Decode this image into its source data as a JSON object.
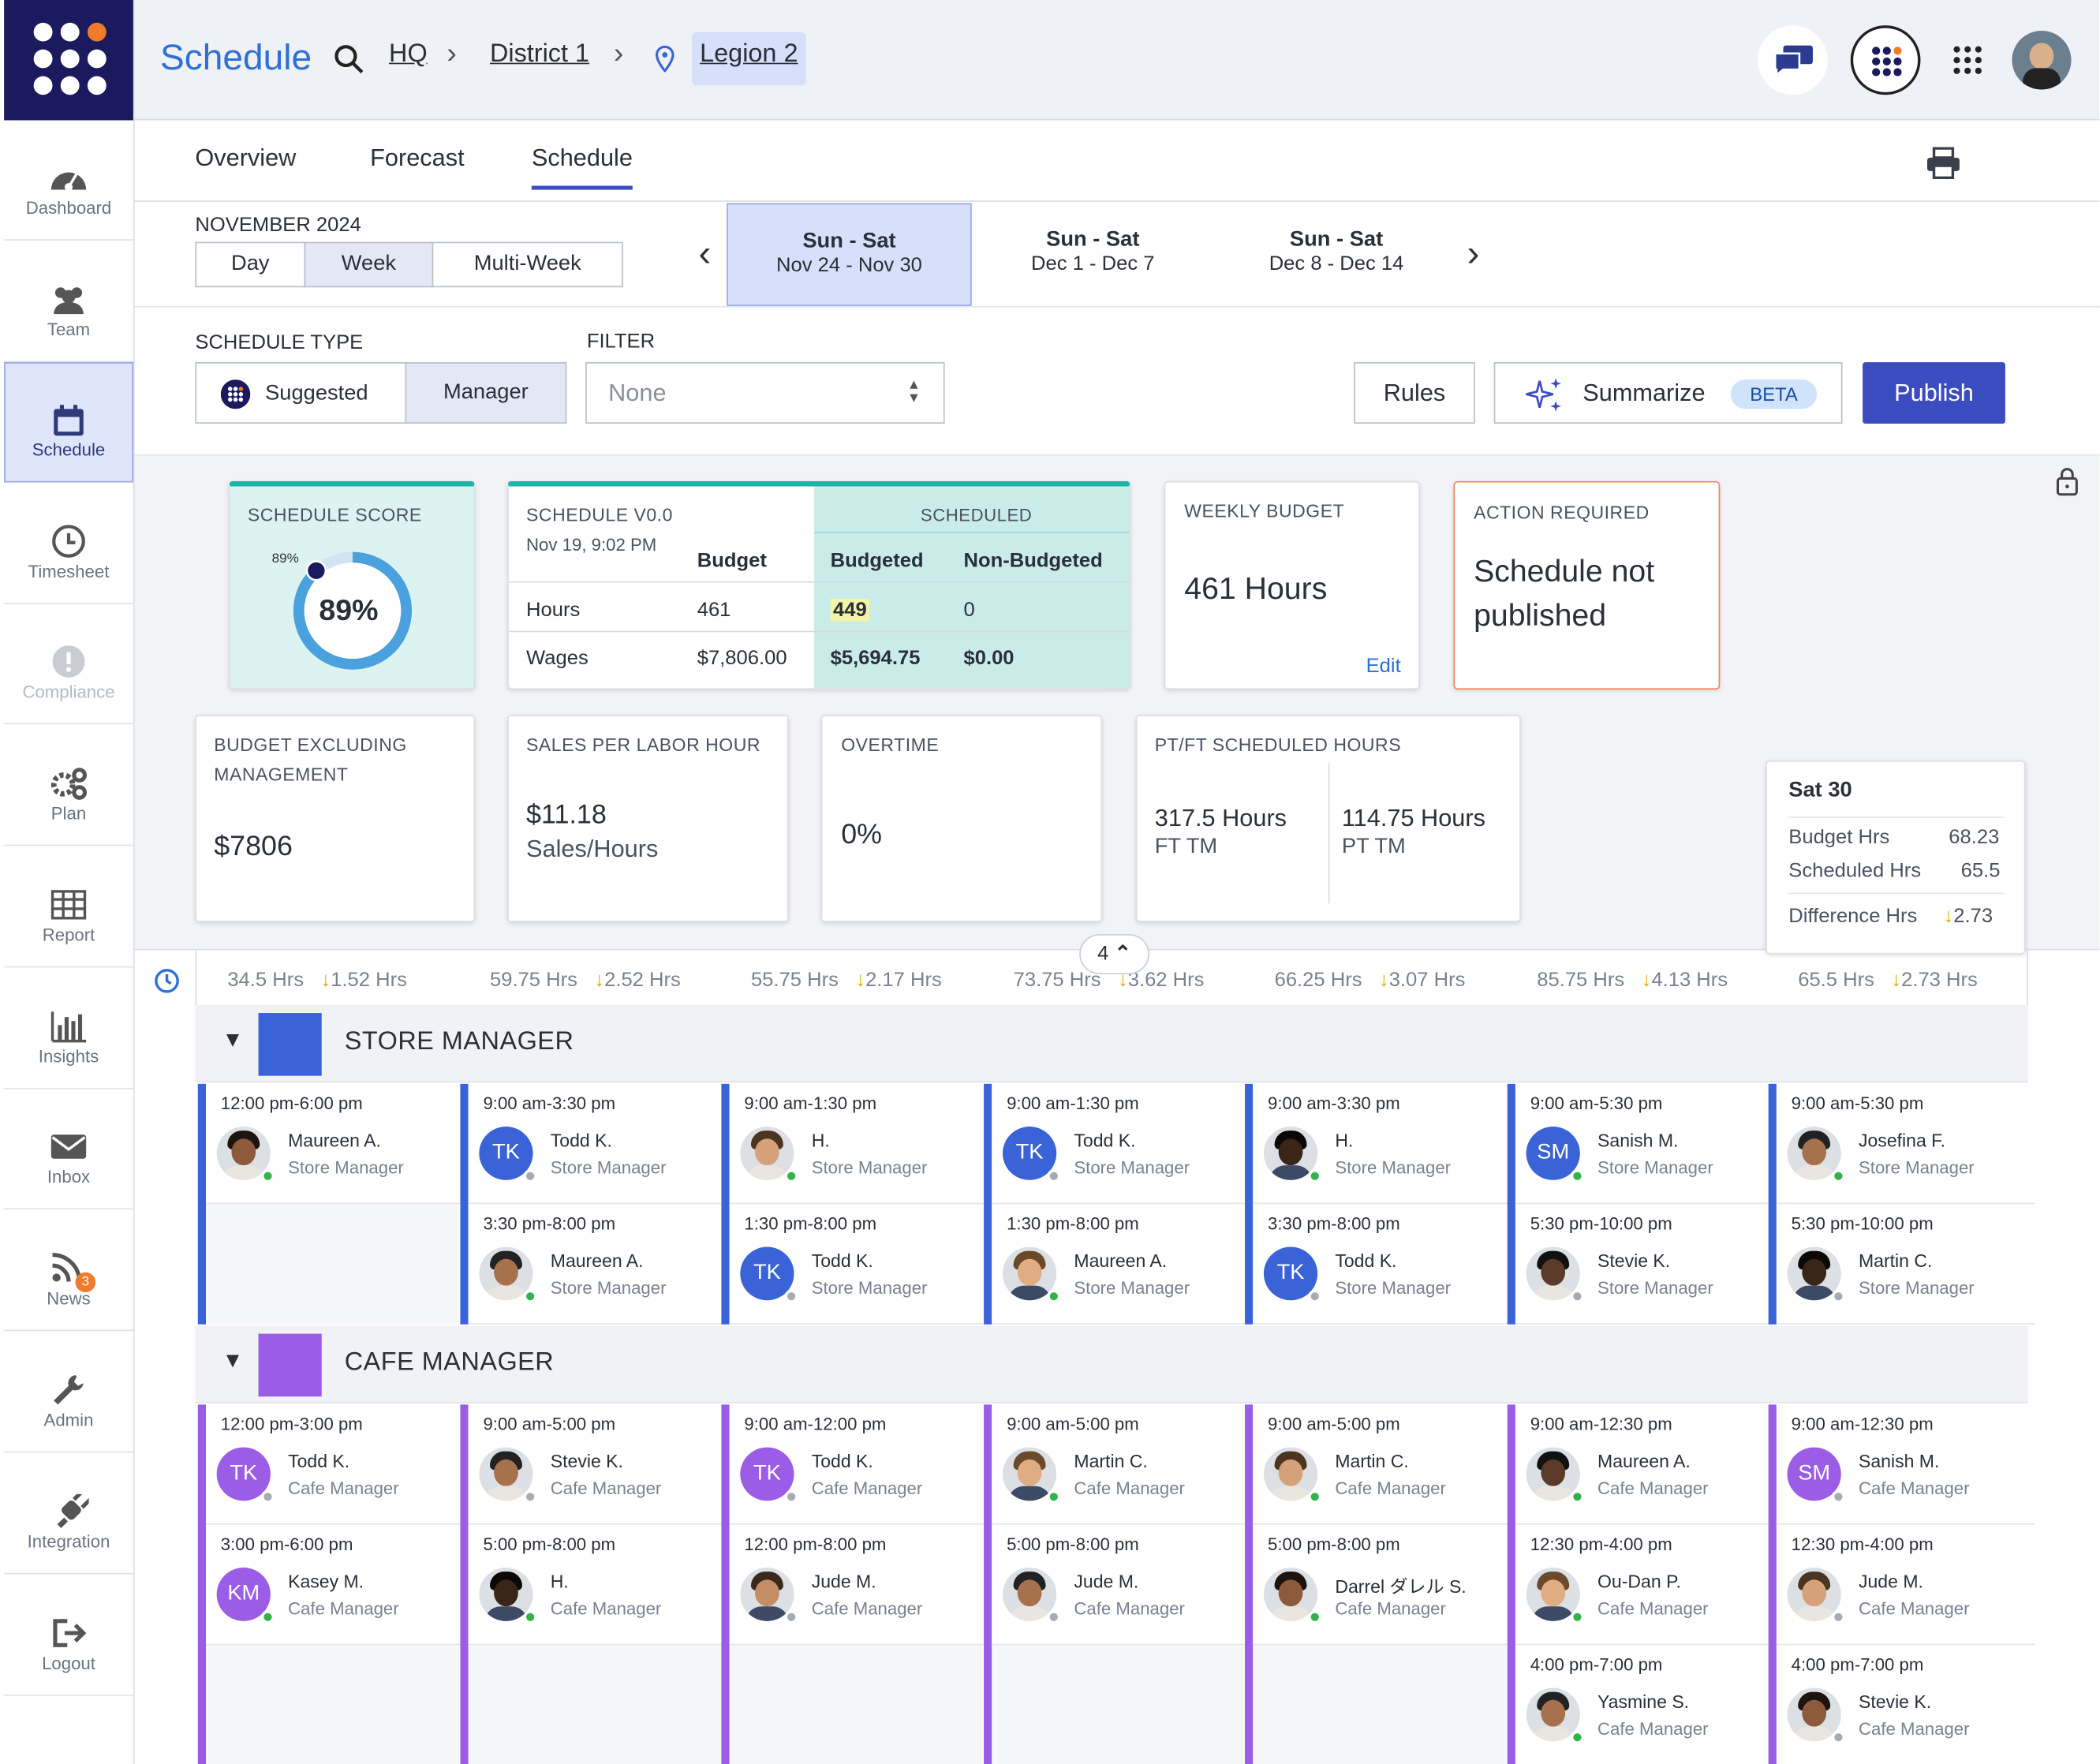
{
  "app": {
    "title": "Schedule"
  },
  "breadcrumb": [
    "HQ",
    "District 1",
    "Legion 2"
  ],
  "sidebar": [
    {
      "label": "Dashboard",
      "icon": "dashboard-icon"
    },
    {
      "label": "Team",
      "icon": "team-icon"
    },
    {
      "label": "Schedule",
      "icon": "calendar-icon",
      "active": true
    },
    {
      "label": "Timesheet",
      "icon": "clock-icon"
    },
    {
      "label": "Compliance",
      "icon": "alert-icon"
    },
    {
      "label": "Plan",
      "icon": "gears-icon"
    },
    {
      "label": "Report",
      "icon": "table-icon"
    },
    {
      "label": "Insights",
      "icon": "bar-chart-icon"
    },
    {
      "label": "Inbox",
      "icon": "mail-icon"
    },
    {
      "label": "News",
      "icon": "rss-icon",
      "badge": "3"
    },
    {
      "label": "Admin",
      "icon": "wrench-icon"
    },
    {
      "label": "Integration",
      "icon": "plug-icon"
    },
    {
      "label": "Logout",
      "icon": "logout-icon"
    }
  ],
  "tabs": [
    "Overview",
    "Forecast",
    "Schedule"
  ],
  "month": "NOVEMBER 2024",
  "view_modes": [
    "Day",
    "Week",
    "Multi-Week"
  ],
  "weeks": [
    {
      "days": "Sun - Sat",
      "range": "Nov 24 - Nov 30"
    },
    {
      "days": "Sun - Sat",
      "range": "Dec 1 - Dec 7"
    },
    {
      "days": "Sun - Sat",
      "range": "Dec 8 - Dec 14"
    }
  ],
  "schedule_type": {
    "label": "SCHEDULE TYPE",
    "options": [
      "Suggested",
      "Manager"
    ]
  },
  "filter": {
    "label": "FILTER",
    "value": "None"
  },
  "buttons": {
    "rules": "Rules",
    "summarize": "Summarize",
    "beta": "BETA",
    "publish": "Publish"
  },
  "score": {
    "title": "SCHEDULE SCORE",
    "value": "89%",
    "marker": "89%",
    "fraction": 0.89
  },
  "version": {
    "title": "SCHEDULE V0.0",
    "date": "Nov 19, 9:02 PM",
    "scheduled_label": "SCHEDULED",
    "headers": [
      "Budget",
      "Budgeted",
      "Non-Budgeted"
    ],
    "rows": [
      {
        "label": "Hours",
        "budget": "461",
        "budgeted": "449",
        "non": "0"
      },
      {
        "label": "Wages",
        "budget": "$7,806.00",
        "budgeted": "$5,694.75",
        "non": "$0.00"
      }
    ]
  },
  "weekly_budget": {
    "title": "WEEKLY BUDGET",
    "value": "461 Hours",
    "edit": "Edit"
  },
  "action": {
    "title": "ACTION REQUIRED",
    "line1": "Schedule not",
    "line2": "published"
  },
  "budget_ex": {
    "title1": "BUDGET EXCLUDING",
    "title2": "MANAGEMENT",
    "value": "$7806"
  },
  "splh": {
    "title": "SALES PER LABOR HOUR",
    "value": "$11.18",
    "unit": "Sales/Hours"
  },
  "overtime": {
    "title": "OVERTIME",
    "value": "0%"
  },
  "ptft": {
    "title": "PT/FT SCHEDULED HOURS",
    "ft_value": "317.5 Hours",
    "ft_label": "FT TM",
    "pt_value": "114.75 Hours",
    "pt_label": "PT TM"
  },
  "tooltip": {
    "title": "Sat 30",
    "rows": [
      {
        "k": "Budget Hrs",
        "v": "68.23"
      },
      {
        "k": "Scheduled Hrs",
        "v": "65.5"
      }
    ],
    "diff_k": "Difference Hrs",
    "diff_v": "2.73"
  },
  "collapse_count": "4",
  "day_hours": [
    {
      "hrs": "34.5 Hrs",
      "diff": "1.52 Hrs"
    },
    {
      "hrs": "59.75 Hrs",
      "diff": "2.52 Hrs"
    },
    {
      "hrs": "55.75 Hrs",
      "diff": "2.17 Hrs"
    },
    {
      "hrs": "73.75 Hrs",
      "diff": "3.62 Hrs"
    },
    {
      "hrs": "66.25 Hrs",
      "diff": "3.07 Hrs"
    },
    {
      "hrs": "85.75 Hrs",
      "diff": "4.13 Hrs"
    },
    {
      "hrs": "65.5 Hrs",
      "diff": "2.73 Hrs"
    }
  ],
  "groups": [
    {
      "title": "STORE MANAGER",
      "color": "#3a63d8",
      "days": [
        [
          {
            "time": "12:00 pm-6:00 pm",
            "name": "Maureen A.",
            "role": "Store Manager",
            "avatar": "photo",
            "online": true
          }
        ],
        [
          {
            "time": "9:00 am-3:30 pm",
            "name": "Todd K.",
            "role": "Store Manager",
            "initials": "TK",
            "avatar": "#3a63d8"
          },
          {
            "time": "3:30 pm-8:00 pm",
            "name": "Maureen A.",
            "role": "Store Manager",
            "avatar": "photo",
            "online": true
          }
        ],
        [
          {
            "time": "9:00 am-1:30 pm",
            "name": "H.",
            "role": "Store Manager",
            "avatar": "photo",
            "online": true
          },
          {
            "time": "1:30 pm-8:00 pm",
            "name": "Todd K.",
            "role": "Store Manager",
            "initials": "TK",
            "avatar": "#3a63d8"
          }
        ],
        [
          {
            "time": "9:00 am-1:30 pm",
            "name": "Todd K.",
            "role": "Store Manager",
            "initials": "TK",
            "avatar": "#3a63d8"
          },
          {
            "time": "1:30 pm-8:00 pm",
            "name": "Maureen A.",
            "role": "Store Manager",
            "avatar": "photo",
            "online": true
          }
        ],
        [
          {
            "time": "9:00 am-3:30 pm",
            "name": "H.",
            "role": "Store Manager",
            "avatar": "photo",
            "online": true
          },
          {
            "time": "3:30 pm-8:00 pm",
            "name": "Todd K.",
            "role": "Store Manager",
            "initials": "TK",
            "avatar": "#3a63d8"
          }
        ],
        [
          {
            "time": "9:00 am-5:30 pm",
            "name": "Sanish M.",
            "role": "Store Manager",
            "initials": "SM",
            "avatar": "#3a63d8",
            "online": true
          },
          {
            "time": "5:30 pm-10:00 pm",
            "name": "Stevie K.",
            "role": "Store Manager",
            "avatar": "photo"
          }
        ],
        [
          {
            "time": "9:00 am-5:30 pm",
            "name": "Josefina F.",
            "role": "Store Manager",
            "avatar": "photo",
            "online": true
          },
          {
            "time": "5:30 pm-10:00 pm",
            "name": "Martin C.",
            "role": "Store Manager",
            "avatar": "photo"
          }
        ]
      ]
    },
    {
      "title": "CAFE MANAGER",
      "color": "#9b5de5",
      "days": [
        [
          {
            "time": "12:00 pm-3:00 pm",
            "name": "Todd K.",
            "role": "Cafe Manager",
            "initials": "TK",
            "avatar": "#9b5de5"
          },
          {
            "time": "3:00 pm-6:00 pm",
            "name": "Kasey M.",
            "role": "Cafe Manager",
            "initials": "KM",
            "avatar": "#9b5de5",
            "online": true
          }
        ],
        [
          {
            "time": "9:00 am-5:00 pm",
            "name": "Stevie K.",
            "role": "Cafe Manager",
            "avatar": "photo"
          },
          {
            "time": "5:00 pm-8:00 pm",
            "name": "H.",
            "role": "Cafe Manager",
            "avatar": "photo",
            "online": true
          }
        ],
        [
          {
            "time": "9:00 am-12:00 pm",
            "name": "Todd K.",
            "role": "Cafe Manager",
            "initials": "TK",
            "avatar": "#9b5de5"
          },
          {
            "time": "12:00 pm-8:00 pm",
            "name": "Jude M.",
            "role": "Cafe Manager",
            "avatar": "photo"
          }
        ],
        [
          {
            "time": "9:00 am-5:00 pm",
            "name": "Martin C.",
            "role": "Cafe Manager",
            "avatar": "photo",
            "online": true
          },
          {
            "time": "5:00 pm-8:00 pm",
            "name": "Jude M.",
            "role": "Cafe Manager",
            "avatar": "photo"
          }
        ],
        [
          {
            "time": "9:00 am-5:00 pm",
            "name": "Martin C.",
            "role": "Cafe Manager",
            "avatar": "photo",
            "online": true
          },
          {
            "time": "5:00 pm-8:00 pm",
            "name": "Darrel ダレル S.",
            "role": "Cafe Manager",
            "avatar": "photo",
            "online": true
          }
        ],
        [
          {
            "time": "9:00 am-12:30 pm",
            "name": "Maureen A.",
            "role": "Cafe Manager",
            "avatar": "photo",
            "online": true
          },
          {
            "time": "12:30 pm-4:00 pm",
            "name": "Ou-Dan P.",
            "role": "Cafe Manager",
            "avatar": "photo",
            "online": true
          },
          {
            "time": "4:00 pm-7:00 pm",
            "name": "Yasmine S.",
            "role": "Cafe Manager",
            "avatar": "photo",
            "online": true
          }
        ],
        [
          {
            "time": "9:00 am-12:30 pm",
            "name": "Sanish M.",
            "role": "Cafe Manager",
            "initials": "SM",
            "avatar": "#9b5de5"
          },
          {
            "time": "12:30 pm-4:00 pm",
            "name": "Jude M.",
            "role": "Cafe Manager",
            "avatar": "photo"
          },
          {
            "time": "4:00 pm-7:00 pm",
            "name": "Stevie K.",
            "role": "Cafe Manager",
            "avatar": "photo"
          }
        ]
      ]
    }
  ]
}
